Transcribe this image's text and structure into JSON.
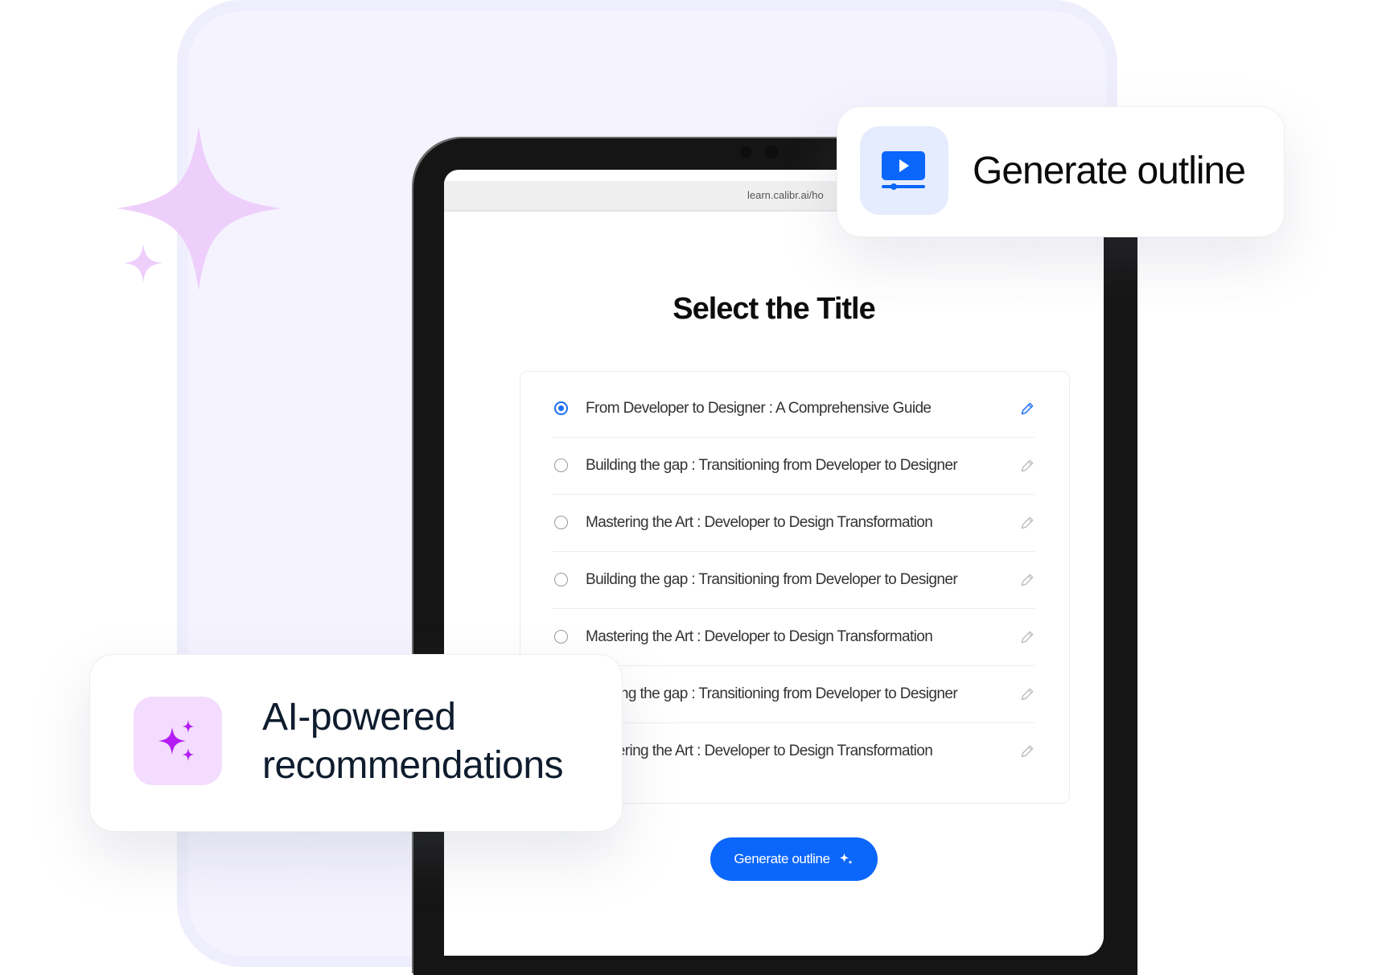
{
  "colors": {
    "accent_blue": "#0b66fb",
    "sparkle_purple": "#b41cf6",
    "sparkle_light": "#eecffb",
    "panel_lavender": "#f4f3fe"
  },
  "browser": {
    "url": "learn.calibr.ai/ho"
  },
  "page": {
    "title": "Select the Title",
    "options": [
      {
        "label": "From Developer to Designer : A Comprehensive Guide",
        "selected": true
      },
      {
        "label": "Building the gap : Transitioning from Developer to Designer",
        "selected": false
      },
      {
        "label": "Mastering the Art : Developer to Design Transformation",
        "selected": false
      },
      {
        "label": "Building the gap : Transitioning from Developer to Designer",
        "selected": false
      },
      {
        "label": "Mastering the Art : Developer to Design Transformation",
        "selected": false
      },
      {
        "label": "Building the gap : Transitioning from Developer to Designer",
        "selected": false
      },
      {
        "label": "Mastering the Art : Developer to Design Transformation",
        "selected": false
      }
    ],
    "generate_button": "Generate outline"
  },
  "feature_cards": {
    "top": {
      "icon": "video-play-icon",
      "label": "Generate outline"
    },
    "bottom": {
      "icon": "sparkles-icon",
      "line1": "AI-powered",
      "line2": "recommendations"
    }
  }
}
